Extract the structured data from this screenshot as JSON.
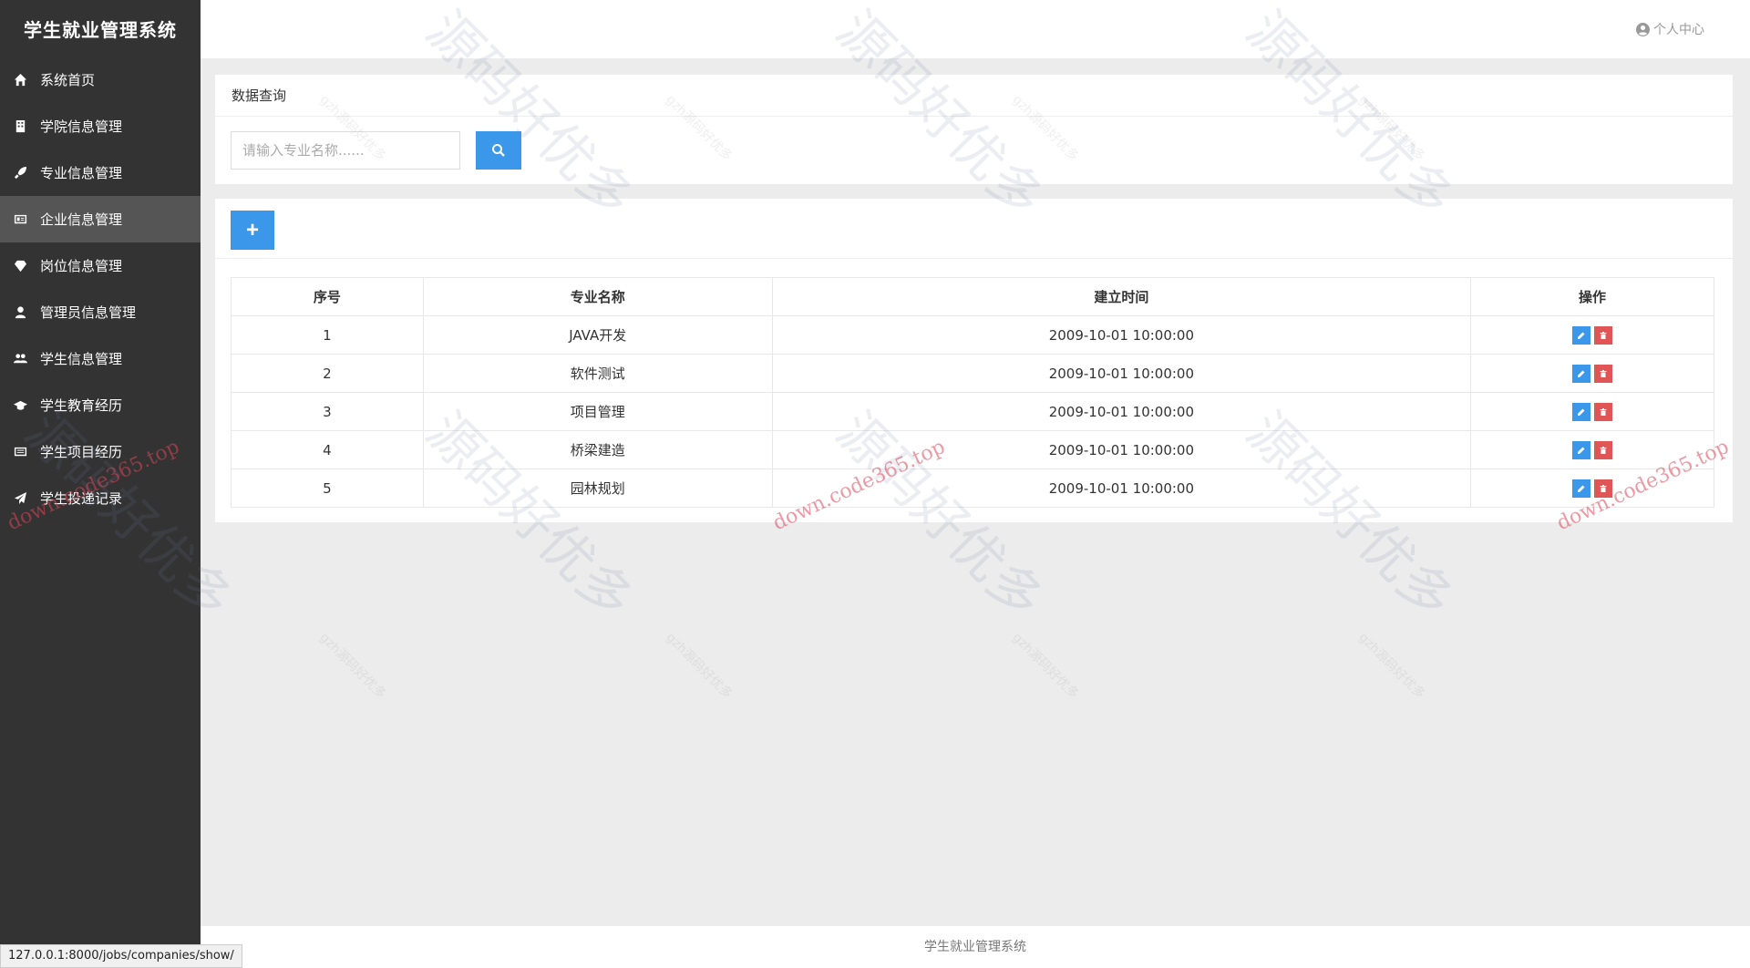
{
  "app": {
    "title": "学生就业管理系统"
  },
  "sidebar": {
    "items": [
      {
        "label": "系统首页",
        "icon": "home-icon"
      },
      {
        "label": "学院信息管理",
        "icon": "building-icon"
      },
      {
        "label": "专业信息管理",
        "icon": "rocket-icon"
      },
      {
        "label": "企业信息管理",
        "icon": "id-card-icon",
        "active": true
      },
      {
        "label": "岗位信息管理",
        "icon": "diamond-icon"
      },
      {
        "label": "管理员信息管理",
        "icon": "user-icon"
      },
      {
        "label": "学生信息管理",
        "icon": "users-icon"
      },
      {
        "label": "学生教育经历",
        "icon": "graduation-cap-icon"
      },
      {
        "label": "学生项目经历",
        "icon": "newspaper-icon"
      },
      {
        "label": "学生投递记录",
        "icon": "paper-plane-icon"
      }
    ]
  },
  "header": {
    "user_center": "个人中心"
  },
  "query": {
    "title": "数据查询",
    "placeholder": "请输入专业名称......"
  },
  "list": {
    "add_label": "+",
    "columns": [
      "序号",
      "专业名称",
      "建立时间",
      "操作"
    ],
    "rows": [
      {
        "idx": "1",
        "name": "JAVA开发",
        "time": "2009-10-01 10:00:00"
      },
      {
        "idx": "2",
        "name": "软件测试",
        "time": "2009-10-01 10:00:00"
      },
      {
        "idx": "3",
        "name": "项目管理",
        "time": "2009-10-01 10:00:00"
      },
      {
        "idx": "4",
        "name": "桥梁建造",
        "time": "2009-10-01 10:00:00"
      },
      {
        "idx": "5",
        "name": "园林规划",
        "time": "2009-10-01 10:00:00"
      }
    ]
  },
  "footer": {
    "text": "学生就业管理系统"
  },
  "status": {
    "url": "127.0.0.1:8000/jobs/companies/show/"
  },
  "colors": {
    "sidebar": "#333333",
    "active": "#555555",
    "primary": "#3a97ea",
    "danger": "#e05555"
  },
  "watermarks": {
    "cn": "源码好优多",
    "url": "down.code365.top",
    "small": "gzh源码好优多"
  }
}
